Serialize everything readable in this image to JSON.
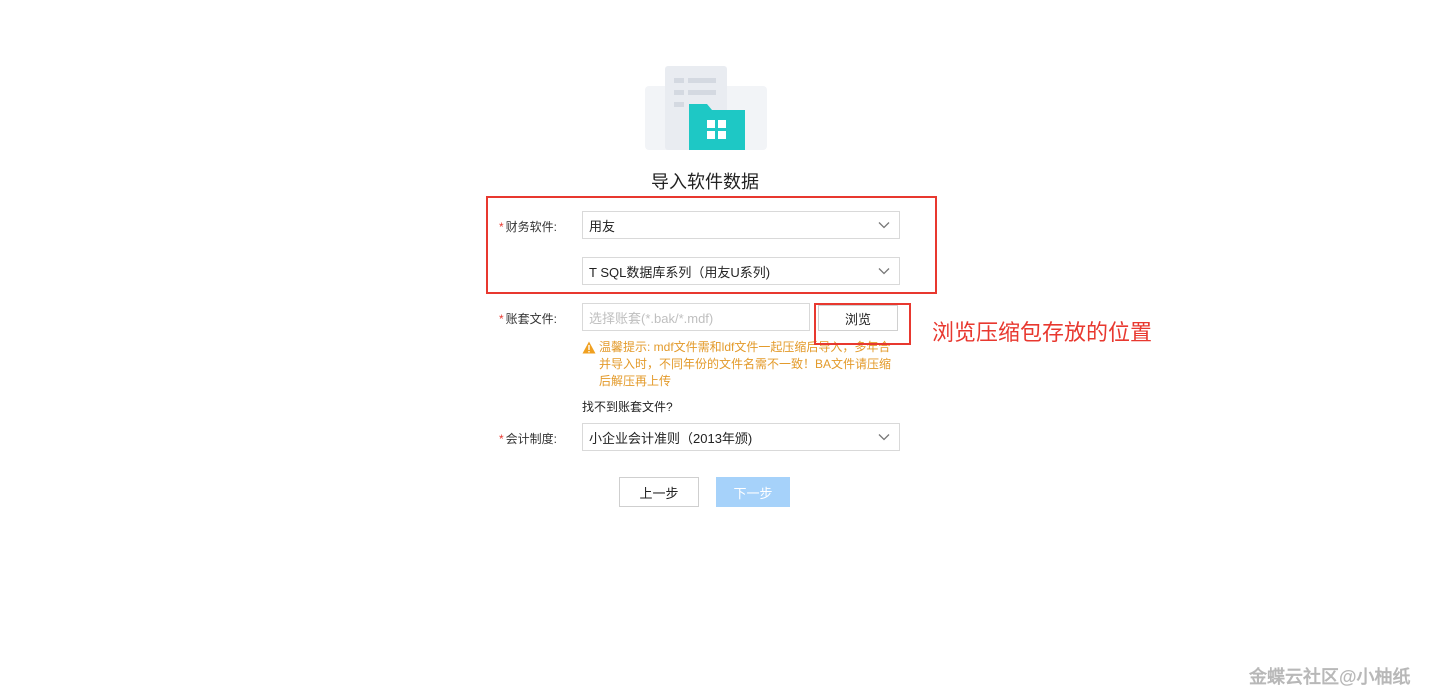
{
  "title": "导入软件数据",
  "required_mark": "*",
  "form": {
    "finance_software": {
      "label": "财务软件:",
      "vendor_value": "用友",
      "product_value": "T SQL数据库系列（用友U系列)"
    },
    "account_file": {
      "label": "账套文件:",
      "placeholder": "选择账套(*.bak/*.mdf)",
      "browse_label": "浏览"
    },
    "warning": {
      "text": "温馨提示: mdf文件需和ldf文件一起压缩后导入，多年合并导入时，不同年份的文件名需不一致！BA文件请压缩后解压再上传"
    },
    "help_link": "找不到账套文件?",
    "accounting_standard": {
      "label": "会计制度:",
      "value": "小企业会计准则（2013年颁)"
    }
  },
  "buttons": {
    "prev": "上一步",
    "next": "下一步"
  },
  "annotation": {
    "text": "浏览压缩包存放的位置",
    "color": "#e8382f"
  },
  "watermark": "金蝶云社区@小柚纸",
  "colors": {
    "accent_teal": "#1ec8c5",
    "required": "#e8382f",
    "warning": "#e39a2a",
    "next_button_disabled": "#a6d2fa"
  }
}
